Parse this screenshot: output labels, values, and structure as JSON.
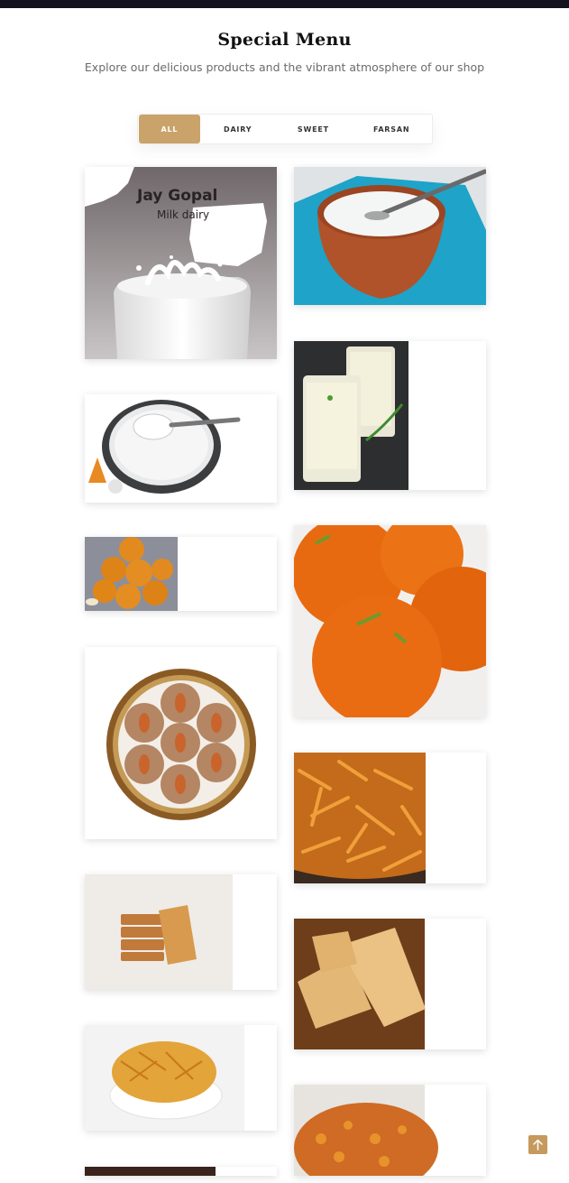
{
  "header": {
    "title": "Special Menu",
    "subtitle": "Explore our delicious products and the vibrant atmosphere of our shop"
  },
  "filters": {
    "tabs": [
      {
        "label": "ALL",
        "active": true
      },
      {
        "label": "DAIRY",
        "active": false
      },
      {
        "label": "SWEET",
        "active": false
      },
      {
        "label": "FARSAN",
        "active": false
      }
    ]
  },
  "logo": {
    "brand": "Jay Gopal",
    "tagline": "Milk dairy"
  },
  "gallery": {
    "items": [
      {
        "id": "jay-gopal-milk",
        "category": "DAIRY"
      },
      {
        "id": "curd-pot",
        "category": "DAIRY"
      },
      {
        "id": "lassi-glasses",
        "category": "DAIRY"
      },
      {
        "id": "curd-bowl",
        "category": "DAIRY"
      },
      {
        "id": "peda-sweets",
        "category": "SWEET"
      },
      {
        "id": "motichoor-laddu",
        "category": "SWEET"
      },
      {
        "id": "almond-cookies",
        "category": "SWEET"
      },
      {
        "id": "sev-farsan",
        "category": "FARSAN"
      },
      {
        "id": "rusk-toast",
        "category": "FARSAN"
      },
      {
        "id": "puff-pastry",
        "category": "FARSAN"
      },
      {
        "id": "sev-bowl",
        "category": "FARSAN"
      },
      {
        "id": "mixture-farsan",
        "category": "FARSAN"
      },
      {
        "id": "dark-item",
        "category": "FARSAN"
      }
    ]
  },
  "colors": {
    "accent": "#c9a36a",
    "topbar": "#14121f",
    "scroll_button": "#c6995d"
  },
  "icons": {
    "scroll_top": "arrow-up-icon"
  }
}
